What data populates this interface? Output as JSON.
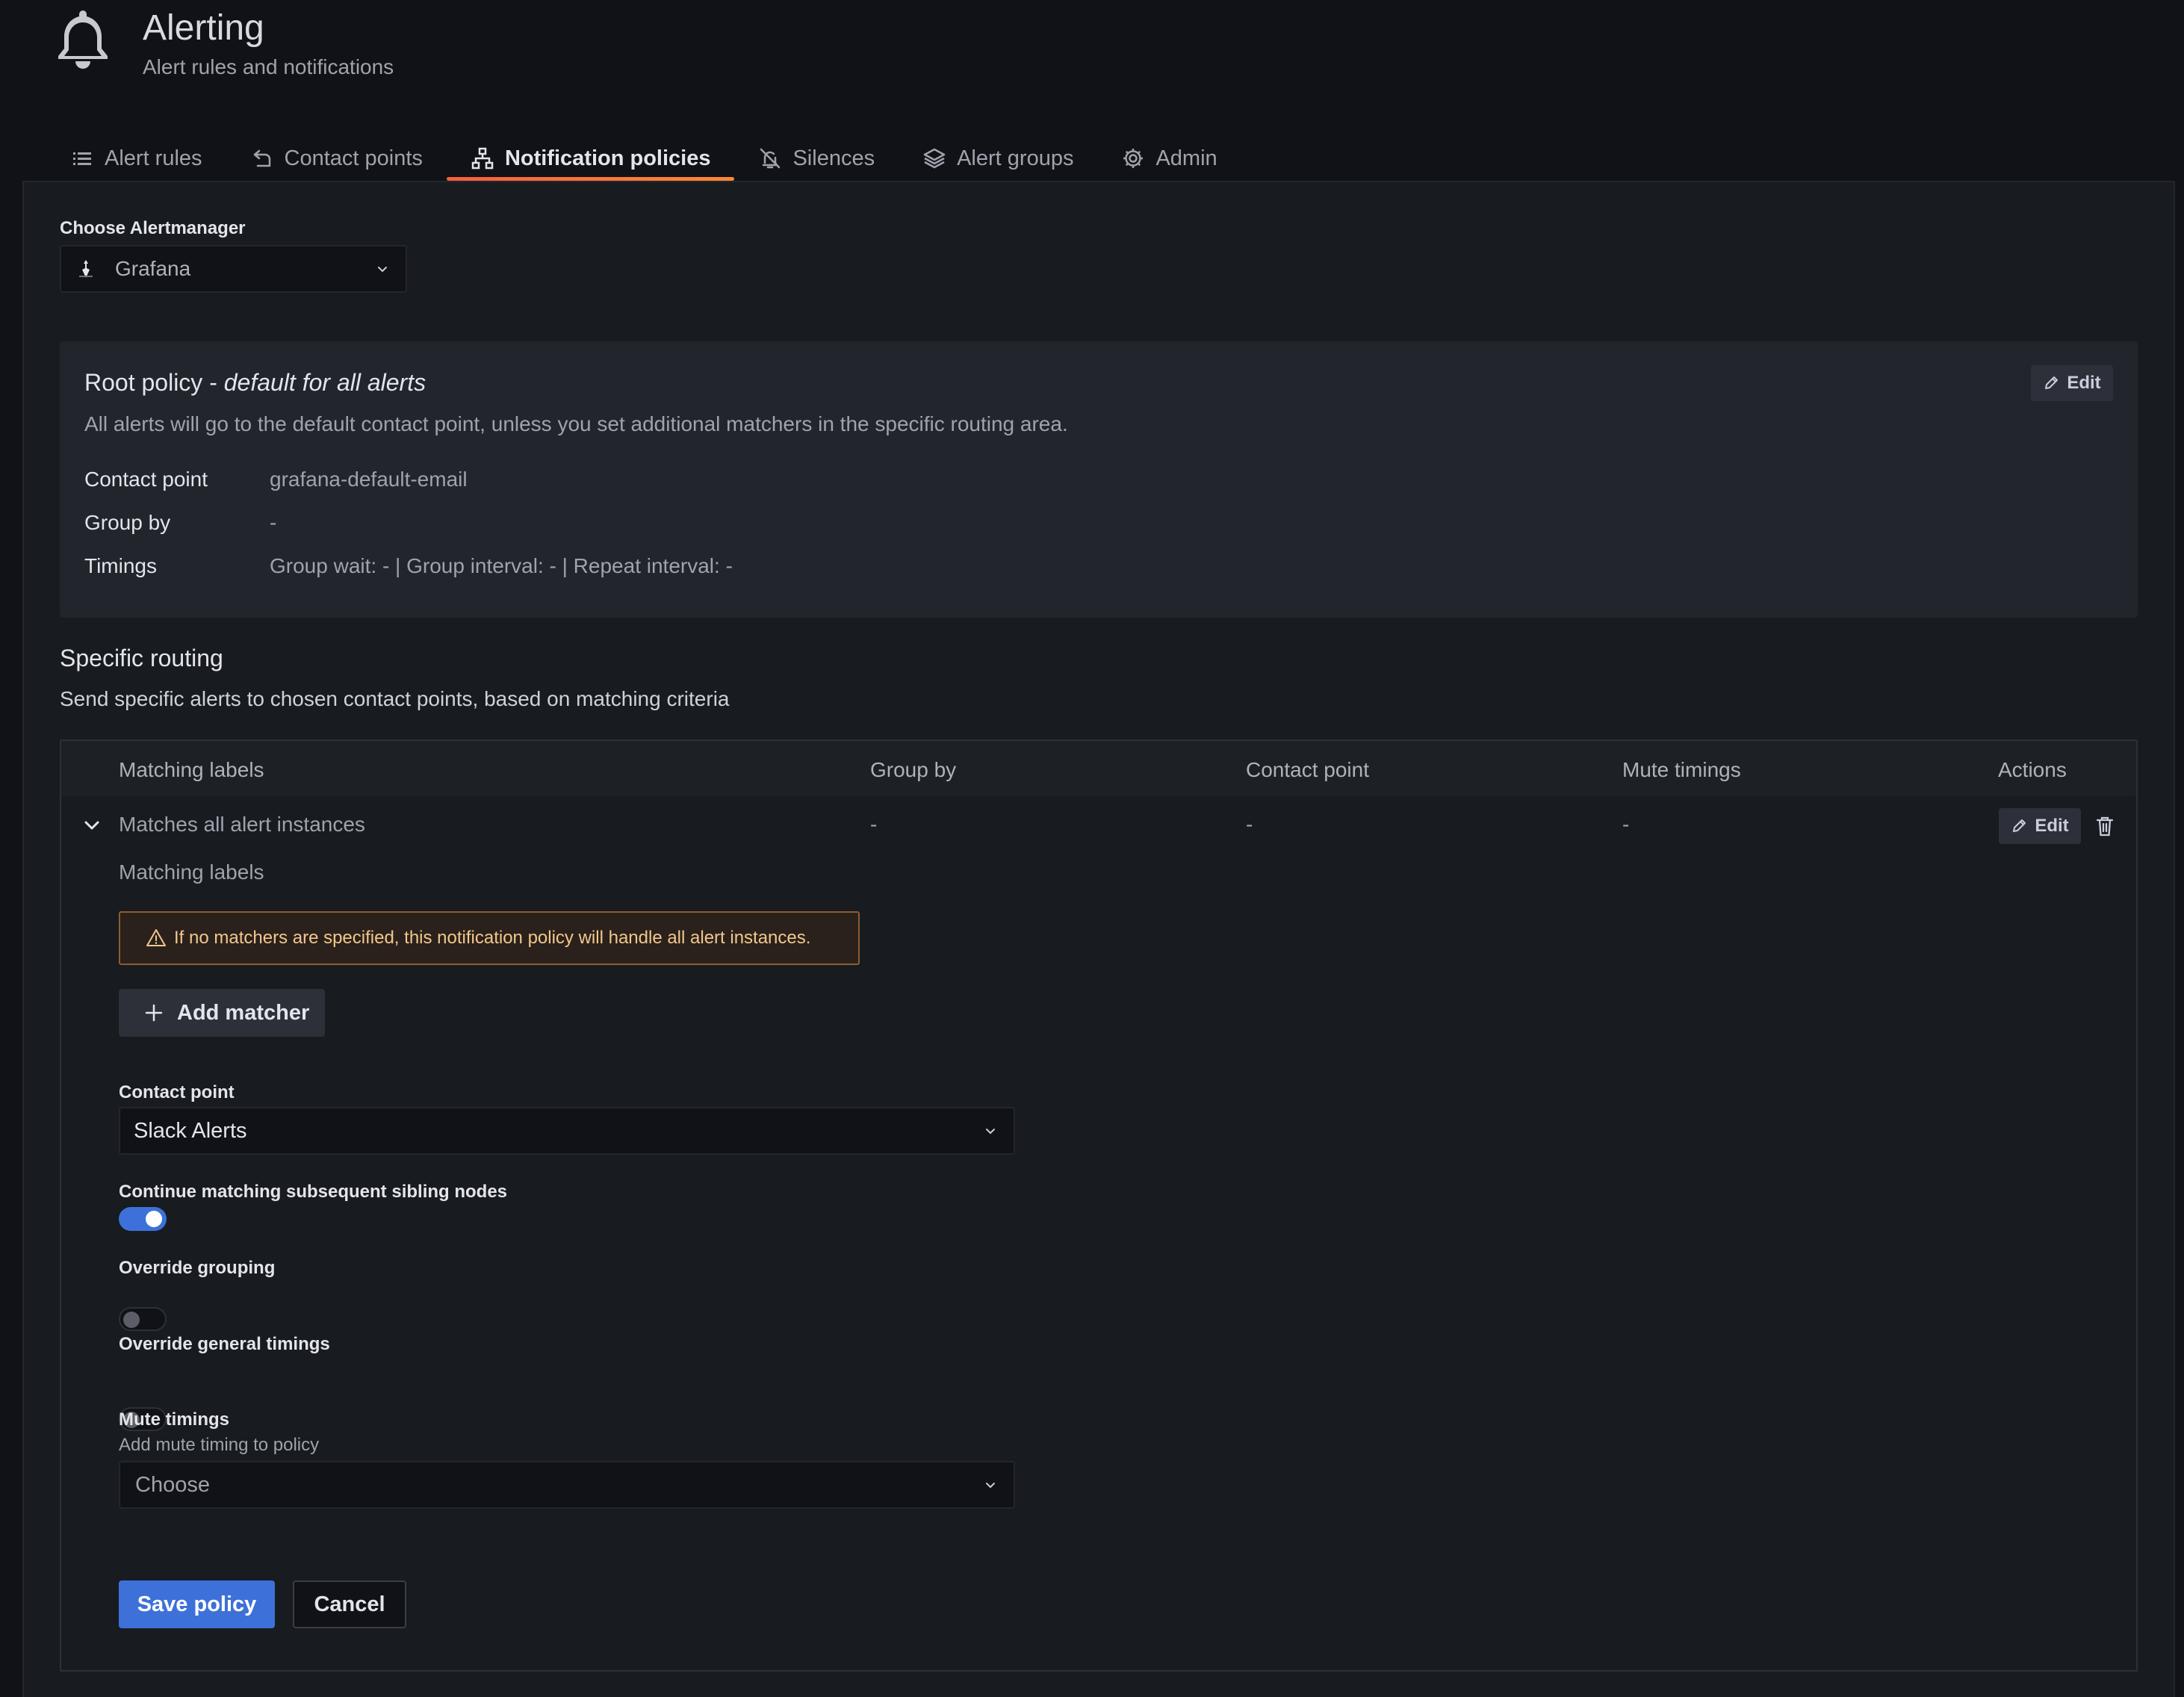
{
  "header": {
    "title": "Alerting",
    "subtitle": "Alert rules and notifications",
    "icon": "bell-icon"
  },
  "tabs": [
    {
      "label": "Alert rules",
      "icon": "list-icon",
      "active": false
    },
    {
      "label": "Contact points",
      "icon": "comment-arrow-icon",
      "active": false
    },
    {
      "label": "Notification policies",
      "icon": "sitemap-icon",
      "active": true
    },
    {
      "label": "Silences",
      "icon": "bell-slash-icon",
      "active": false
    },
    {
      "label": "Alert groups",
      "icon": "layer-group-icon",
      "active": false
    },
    {
      "label": "Admin",
      "icon": "cog-icon",
      "active": false
    }
  ],
  "alertmanager": {
    "label": "Choose Alertmanager",
    "selected": "Grafana"
  },
  "root_policy": {
    "title": "Root policy - ",
    "title_emphasis": "default for all alerts",
    "description": "All alerts will go to the default contact point, unless you set additional matchers in the specific routing area.",
    "edit_label": "Edit",
    "fields": [
      {
        "key": "Contact point",
        "value": "grafana-default-email"
      },
      {
        "key": "Group by",
        "value": "-"
      },
      {
        "key": "Timings",
        "value": "Group wait: - | Group interval: - | Repeat interval: -"
      }
    ]
  },
  "specific_routing": {
    "title": "Specific routing",
    "description": "Send specific alerts to chosen contact points, based on matching criteria",
    "columns": [
      "Matching labels",
      "Group by",
      "Contact point",
      "Mute timings",
      "Actions"
    ],
    "row": {
      "matching": "Matches all alert instances",
      "group_by": "-",
      "contact_point": "-",
      "mute_timings": "-",
      "edit_label": "Edit"
    }
  },
  "policy_form": {
    "matching_labels_label": "Matching labels",
    "warning": "If no matchers are specified, this notification policy will handle all alert instances.",
    "add_matcher_label": "Add matcher",
    "contact_point_label": "Contact point",
    "contact_point_value": "Slack Alerts",
    "continue_label": "Continue matching subsequent sibling nodes",
    "continue_on": true,
    "override_grouping_label": "Override grouping",
    "override_grouping_on": false,
    "override_timings_label": "Override general timings",
    "override_timings_on": false,
    "mute_timings_label": "Mute timings",
    "mute_timings_sub": "Add mute timing to policy",
    "mute_timings_placeholder": "Choose",
    "save_label": "Save policy",
    "cancel_label": "Cancel"
  },
  "colors": {
    "background": "#111217",
    "panel": "#181b1f",
    "primary": "#3d71d9",
    "tab_accent": "#ff8833",
    "warning_border": "#8f5c31"
  }
}
